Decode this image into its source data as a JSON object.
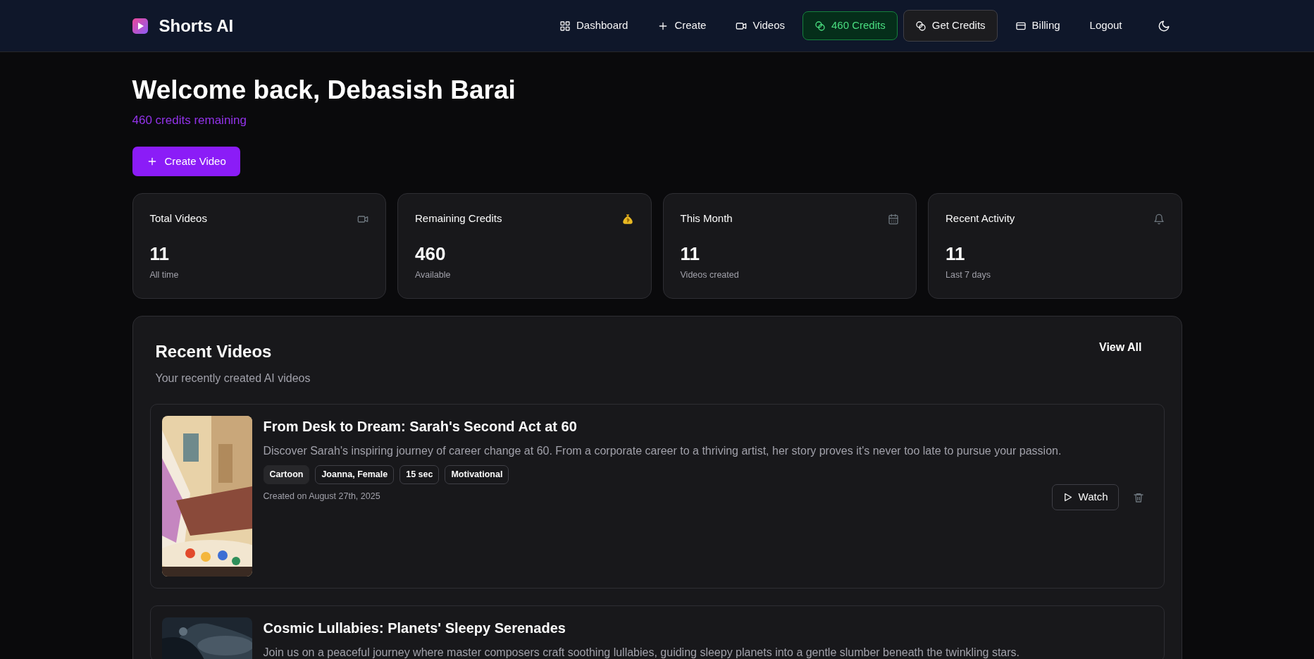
{
  "brand": {
    "name": "Shorts AI"
  },
  "nav": [
    {
      "label": "Dashboard",
      "kind": "link"
    },
    {
      "label": "Create",
      "kind": "link"
    },
    {
      "label": "Videos",
      "kind": "link"
    },
    {
      "label": "460 Credits",
      "kind": "credits"
    },
    {
      "label": "Get Credits",
      "kind": "button"
    },
    {
      "label": "Billing",
      "kind": "link"
    },
    {
      "label": "Logout",
      "kind": "link"
    }
  ],
  "welcome": {
    "title": "Welcome back, Debasish Barai",
    "credits": "460 credits remaining",
    "button": "Create Video"
  },
  "stats": [
    {
      "title": "Total Videos",
      "value": "11",
      "caption": "All time"
    },
    {
      "title": "Remaining Credits",
      "value": "460",
      "caption": "Available"
    },
    {
      "title": "This Month",
      "value": "11",
      "caption": "Videos created"
    },
    {
      "title": "Recent Activity",
      "value": "11",
      "caption": "Last 7 days"
    }
  ],
  "recent": {
    "title": "Recent Videos",
    "subtitle": "Your recently created AI videos",
    "view_all": "View All",
    "videos": [
      {
        "title": "From Desk to Dream: Sarah's Second Act at 60",
        "description": "Discover Sarah's inspiring journey of career change at 60. From a corporate career to a thriving artist, her story proves it's never too late to pursue your passion.",
        "tags": [
          {
            "label": "Cartoon",
            "kind": "filled"
          },
          {
            "label": "Joanna, Female",
            "kind": "outline"
          },
          {
            "label": "15 sec",
            "kind": "outline"
          },
          {
            "label": "Motivational",
            "kind": "outline"
          }
        ],
        "created": "Created on August 27th, 2025",
        "watch": "Watch"
      },
      {
        "title": "Cosmic Lullabies: Planets' Sleepy Serenades",
        "description": "Join us on a peaceful journey where master composers craft soothing lullabies, guiding sleepy planets into a gentle slumber beneath the twinkling stars."
      }
    ]
  }
}
